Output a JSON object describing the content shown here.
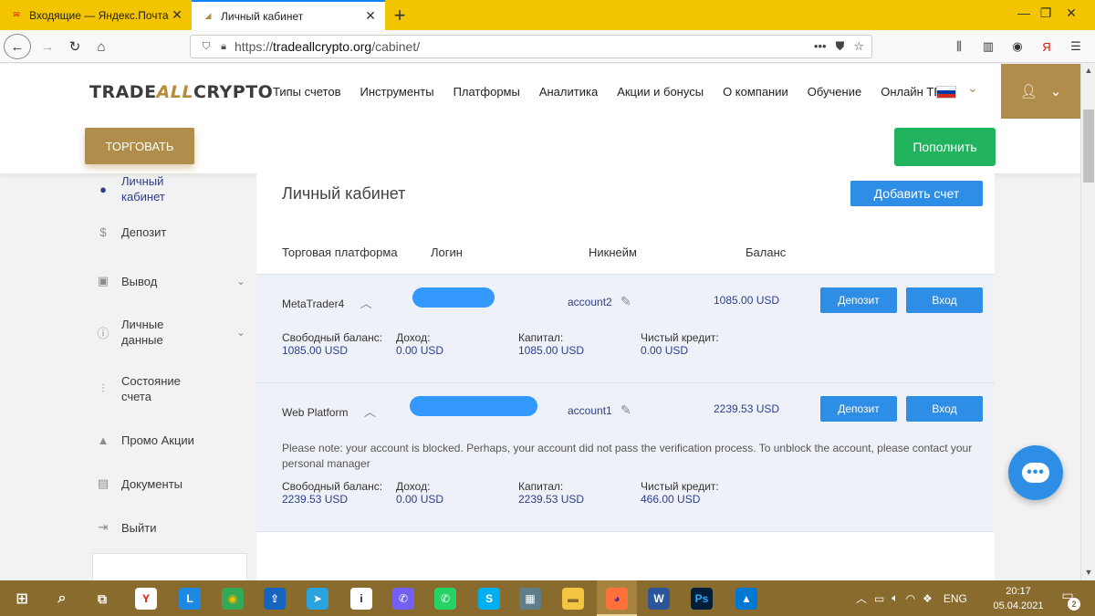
{
  "browser": {
    "tabs": [
      {
        "title": "Входящие — Яндекс.Почта",
        "active": false
      },
      {
        "title": "Личный кабинет",
        "active": true
      }
    ],
    "new_tab": "+",
    "url_prefix": "https://",
    "url_domain": "tradeallcrypto.org",
    "url_path": "/cabinet/",
    "url_menu": "•••",
    "yandex_letter": "Я",
    "window_controls": {
      "minimize": "—",
      "restore": "❐",
      "close": "✕"
    }
  },
  "site": {
    "logo_left": "TRADE",
    "logo_mid": "ALL",
    "logo_right": "CRYPTO",
    "nav": [
      "Типы счетов",
      "Инструменты",
      "Платформы",
      "Аналитика",
      "Акции и бонусы",
      "О компании",
      "Обучение",
      "Онлайн ТВ"
    ],
    "trade_button": "ТОРГОВАТЬ",
    "topup_button": "Пополнить",
    "accent_color": "#b08d4a",
    "primary_color": "#2e8de4",
    "success_color": "#22b35e"
  },
  "sidebar": {
    "items": [
      {
        "label": "Личный кабинет",
        "icon": "user-circle-icon",
        "glyph": "●",
        "active": true,
        "chevron": false
      },
      {
        "label": "Депозит",
        "icon": "deposit-icon",
        "glyph": "$",
        "active": false,
        "chevron": false
      },
      {
        "label": "Вывод",
        "icon": "withdraw-icon",
        "glyph": "▣",
        "active": false,
        "chevron": true
      },
      {
        "label": "Личные данные",
        "icon": "info-icon",
        "glyph": "ⓘ",
        "active": false,
        "chevron": true
      },
      {
        "label": "Состояние счета",
        "icon": "sliders-icon",
        "glyph": "⫶",
        "active": false,
        "chevron": false
      },
      {
        "label": "Промо Акции",
        "icon": "bell-icon",
        "glyph": "▲",
        "active": false,
        "chevron": false
      },
      {
        "label": "Документы",
        "icon": "document-icon",
        "glyph": "▤",
        "active": false,
        "chevron": false
      },
      {
        "label": "Выйти",
        "icon": "logout-icon",
        "glyph": "⇥",
        "active": false,
        "chevron": false
      }
    ]
  },
  "main": {
    "title": "Личный кабинет",
    "add_account": "Добавить счет",
    "columns": [
      "Торговая платформа",
      "Логин",
      "Никнейм",
      "Баланс"
    ],
    "accounts": [
      {
        "platform": "MetaTrader4",
        "nickname": "account2",
        "balance": "1085.00 USD",
        "deposit_label": "Депозит",
        "login_label": "Вход",
        "note": "",
        "stats": [
          {
            "label": "Свободный баланс:",
            "value": "1085.00 USD"
          },
          {
            "label": "Доход:",
            "value": "0.00 USD"
          },
          {
            "label": "Капитал:",
            "value": "1085.00 USD"
          },
          {
            "label": "Чистый кредит:",
            "value": "0.00 USD"
          }
        ]
      },
      {
        "platform": "Web Platform",
        "nickname": "account1",
        "balance": "2239.53 USD",
        "deposit_label": "Депозит",
        "login_label": "Вход",
        "note": "Please note: your account is blocked. Perhaps, your account did not pass the verification process. To unblock the account, please contact your personal manager",
        "stats": [
          {
            "label": "Свободный баланс:",
            "value": "2239.53 USD"
          },
          {
            "label": "Доход:",
            "value": "0.00 USD"
          },
          {
            "label": "Капитал:",
            "value": "2239.53 USD"
          },
          {
            "label": "Чистый кредит:",
            "value": "466.00 USD"
          }
        ]
      }
    ]
  },
  "taskbar": {
    "lang": "ENG",
    "time": "20:17",
    "date": "05.04.2021",
    "notifications": "2",
    "apps": [
      {
        "name": "yandex-browser-icon",
        "glyph": "Y",
        "bg": "#ffffff",
        "fg": "#e61400"
      },
      {
        "name": "l-app-icon",
        "glyph": "L",
        "bg": "#1e88e5",
        "fg": "#ffffff"
      },
      {
        "name": "chrome-icon",
        "glyph": "◉",
        "bg": "#34a853",
        "fg": "#fbbc05"
      },
      {
        "name": "upload-app-icon",
        "glyph": "⇪",
        "bg": "#1565c0",
        "fg": "#ffffff"
      },
      {
        "name": "telegram-icon",
        "glyph": "➤",
        "bg": "#2aa3df",
        "fg": "#ffffff"
      },
      {
        "name": "info-app-icon",
        "glyph": "i",
        "bg": "#ffffff",
        "fg": "#222222"
      },
      {
        "name": "viber-icon",
        "glyph": "✆",
        "bg": "#7360f2",
        "fg": "#ffffff"
      },
      {
        "name": "whatsapp-icon",
        "glyph": "✆",
        "bg": "#25d366",
        "fg": "#ffffff"
      },
      {
        "name": "skype-icon",
        "glyph": "S",
        "bg": "#00aff0",
        "fg": "#ffffff"
      },
      {
        "name": "calculator-icon",
        "glyph": "▦",
        "bg": "#607d8b",
        "fg": "#ffffff"
      },
      {
        "name": "file-explorer-icon",
        "glyph": "▬",
        "bg": "#f4c542",
        "fg": "#8a6b2e"
      },
      {
        "name": "firefox-icon",
        "glyph": "◕",
        "bg": "#ff7139",
        "fg": "#5b2a86"
      },
      {
        "name": "word-icon",
        "glyph": "W",
        "bg": "#2b579a",
        "fg": "#ffffff"
      },
      {
        "name": "photoshop-icon",
        "glyph": "Ps",
        "bg": "#001e36",
        "fg": "#31a8ff"
      },
      {
        "name": "photos-icon",
        "glyph": "▲",
        "bg": "#0078d4",
        "fg": "#ffffff"
      }
    ]
  }
}
